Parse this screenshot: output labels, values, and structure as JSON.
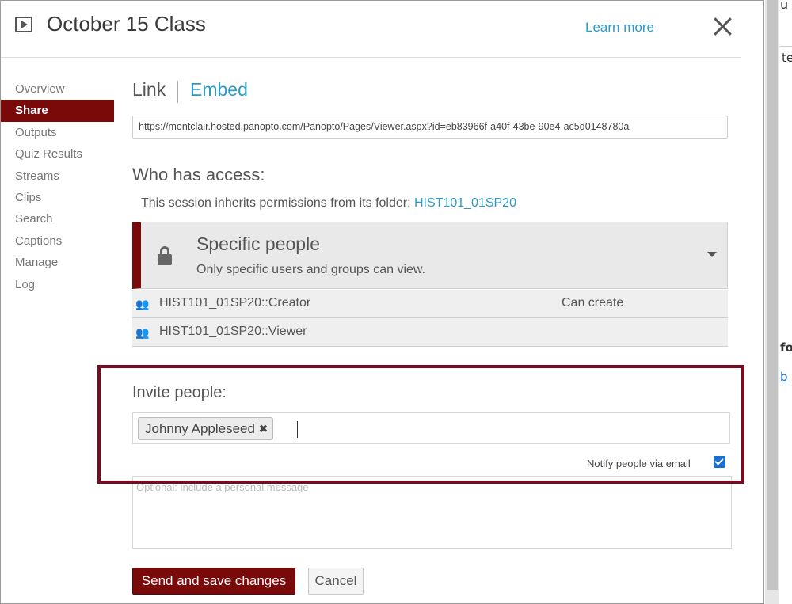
{
  "background": {
    "text_top": "u",
    "text_2": "te",
    "text_3": "fo",
    "text_4": "b"
  },
  "header": {
    "title": "October 15 Class",
    "learn_more": "Learn more"
  },
  "sidebar": {
    "items": [
      {
        "label": "Overview"
      },
      {
        "label": "Share"
      },
      {
        "label": "Outputs"
      },
      {
        "label": "Quiz Results"
      },
      {
        "label": "Streams"
      },
      {
        "label": "Clips"
      },
      {
        "label": "Search"
      },
      {
        "label": "Captions"
      },
      {
        "label": "Manage"
      },
      {
        "label": "Log"
      }
    ],
    "active": "Share"
  },
  "share": {
    "tabs": {
      "link": "Link",
      "embed": "Embed"
    },
    "url": "https://montclair.hosted.panopto.com/Panopto/Pages/Viewer.aspx?id=eb83966f-a40f-43be-90e4-ac5d0148780a",
    "access_title": "Who has access:",
    "inherit_text": "This session inherits permissions from its folder: ",
    "folder_link": "HIST101_01SP20",
    "access_level": {
      "name": "Specific people",
      "description": "Only specific users and groups can view."
    },
    "groups": [
      {
        "name": "HIST101_01SP20::Creator",
        "role": "Can create"
      },
      {
        "name": "HIST101_01SP20::Viewer",
        "role": ""
      }
    ],
    "invite_title": "Invite people:",
    "invitee": "Johnny Appleseed",
    "notify_label": "Notify people via email",
    "notify_checked": true,
    "message_placeholder": "Optional: include a personal message",
    "send_label": "Send and save changes",
    "cancel_label": "Cancel"
  },
  "colors": {
    "accent": "#7a0a0a",
    "link": "#2b9ac9",
    "checkbox": "#1a6fd4"
  }
}
